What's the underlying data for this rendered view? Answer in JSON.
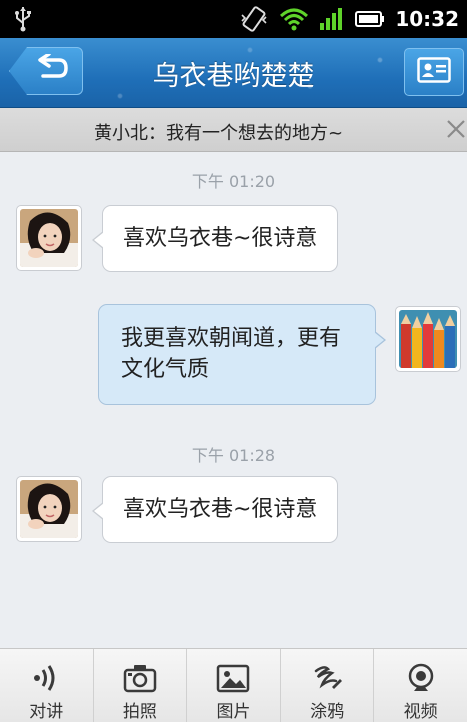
{
  "status_bar": {
    "time": "10:32",
    "icons": [
      "usb-icon",
      "vibrate-icon",
      "wifi-icon",
      "signal-icon",
      "battery-icon"
    ]
  },
  "header": {
    "title": "乌衣巷哟楚楚",
    "back_icon": "back-arrow-icon",
    "profile_icon": "contact-card-icon",
    "bg_color": "#1f6fb8"
  },
  "notice": {
    "text": "黄小北：我有一个想去的地方~",
    "close_icon": "close-icon"
  },
  "messages": [
    {
      "type": "timestamp",
      "text": "下午 01:20"
    },
    {
      "type": "received",
      "text": "喜欢乌衣巷~很诗意",
      "avatar": "girl-avatar"
    },
    {
      "type": "sent",
      "text": "我更喜欢朝闻道，更有文化气质",
      "avatar": "pencils-avatar"
    },
    {
      "type": "timestamp",
      "text": "下午 01:28"
    },
    {
      "type": "received",
      "text": "喜欢乌衣巷~很诗意",
      "avatar": "girl-avatar"
    }
  ],
  "toolbar": {
    "items": [
      {
        "label": "对讲",
        "icon": "voice-waves-icon"
      },
      {
        "label": "拍照",
        "icon": "camera-icon"
      },
      {
        "label": "图片",
        "icon": "picture-icon"
      },
      {
        "label": "涂鸦",
        "icon": "doodle-icon"
      },
      {
        "label": "视频",
        "icon": "webcam-icon"
      }
    ]
  },
  "colors": {
    "header": "#1f6fb8",
    "sent_bubble": "#d6e9f8",
    "received_bubble": "#ffffff",
    "background": "#ebeef2"
  }
}
